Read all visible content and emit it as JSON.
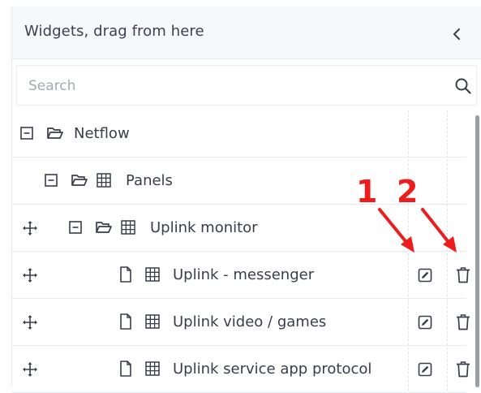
{
  "header": {
    "title": "Widgets, drag from here",
    "collapse_icon": "chevron-left-icon"
  },
  "search": {
    "placeholder": "Search",
    "value": "",
    "icon": "search-icon"
  },
  "tree": {
    "netflow": {
      "label": "Netflow"
    },
    "panels": {
      "label": "Panels"
    },
    "uplink_monitor": {
      "label": "Uplink monitor"
    },
    "widgets": [
      {
        "label": "Uplink - messenger",
        "edit_icon": "edit-icon",
        "delete_icon": "trash-icon"
      },
      {
        "label": "Uplink video / games",
        "edit_icon": "edit-icon",
        "delete_icon": "trash-icon"
      },
      {
        "label": "Uplink service app protocol",
        "edit_icon": "edit-icon",
        "delete_icon": "trash-icon"
      }
    ]
  },
  "annotations": {
    "first": "1",
    "second": "2",
    "color": "#ee1c1c"
  },
  "colors": {
    "text": "#3a3d4a",
    "header_bg": "#f7f8fb",
    "border": "#e8eaf0",
    "scrollbar": "#9a9da6"
  }
}
